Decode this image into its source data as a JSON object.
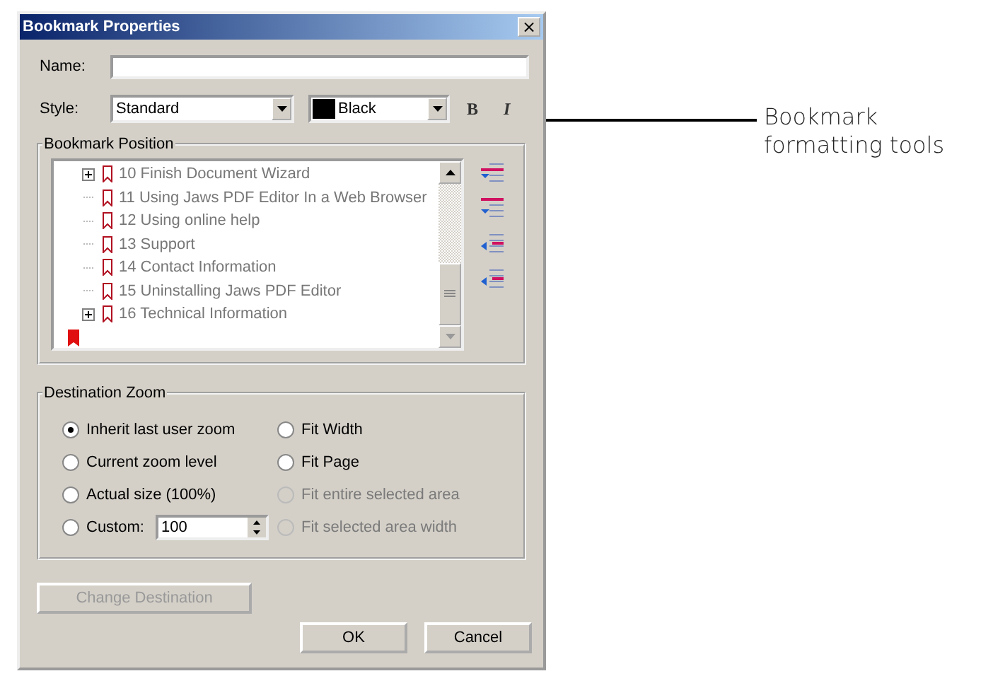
{
  "window": {
    "title": "Bookmark Properties",
    "close": "×"
  },
  "name_field": {
    "label": "Name:"
  },
  "style_row": {
    "label": "Style:",
    "style_value": "Standard",
    "color_value": "Black",
    "bold": "B",
    "italic": "I"
  },
  "bookmark_position": {
    "title": "Bookmark Position",
    "items": [
      {
        "kind": "bookmark",
        "label": "10 Finish Document Wizard",
        "expandable": true
      },
      {
        "kind": "bookmark",
        "label": "11 Using Jaws PDF Editor In a Web Browser",
        "expandable": false
      },
      {
        "kind": "bookmark",
        "label": "12 Using online help",
        "expandable": false
      },
      {
        "kind": "bookmark",
        "label": "13 Support",
        "expandable": false
      },
      {
        "kind": "bookmark",
        "label": "14 Contact Information",
        "expandable": false
      },
      {
        "kind": "bookmark",
        "label": "15 Uninstalling Jaws PDF Editor",
        "expandable": false
      },
      {
        "kind": "bookmark",
        "label": "16 Technical Information",
        "expandable": true
      },
      {
        "kind": "new"
      }
    ]
  },
  "destination_zoom": {
    "title": "Destination Zoom",
    "options": [
      {
        "kind": "plain",
        "label": "Inherit last user zoom",
        "selected": true,
        "disabled": false
      },
      {
        "kind": "plain",
        "label": "Current zoom level",
        "selected": false,
        "disabled": false
      },
      {
        "kind": "plain",
        "label": "Actual size (100%)",
        "selected": false,
        "disabled": false
      },
      {
        "kind": "custom",
        "label": "Custom:",
        "value": "100",
        "selected": false,
        "disabled": false
      },
      {
        "kind": "plain",
        "label": "Fit Width",
        "selected": false,
        "disabled": false
      },
      {
        "kind": "plain",
        "label": "Fit Page",
        "selected": false,
        "disabled": false
      },
      {
        "kind": "plain",
        "label": "Fit entire selected area",
        "selected": false,
        "disabled": true
      },
      {
        "kind": "plain",
        "label": "Fit selected area width",
        "selected": false,
        "disabled": true
      }
    ]
  },
  "buttons": [
    {
      "label": "Change Destination",
      "disabled": true
    },
    {
      "label": "OK",
      "disabled": false
    },
    {
      "label": "Cancel",
      "disabled": false
    }
  ],
  "annotation": {
    "lines": [
      "Bookmark",
      "formatting tools"
    ]
  }
}
